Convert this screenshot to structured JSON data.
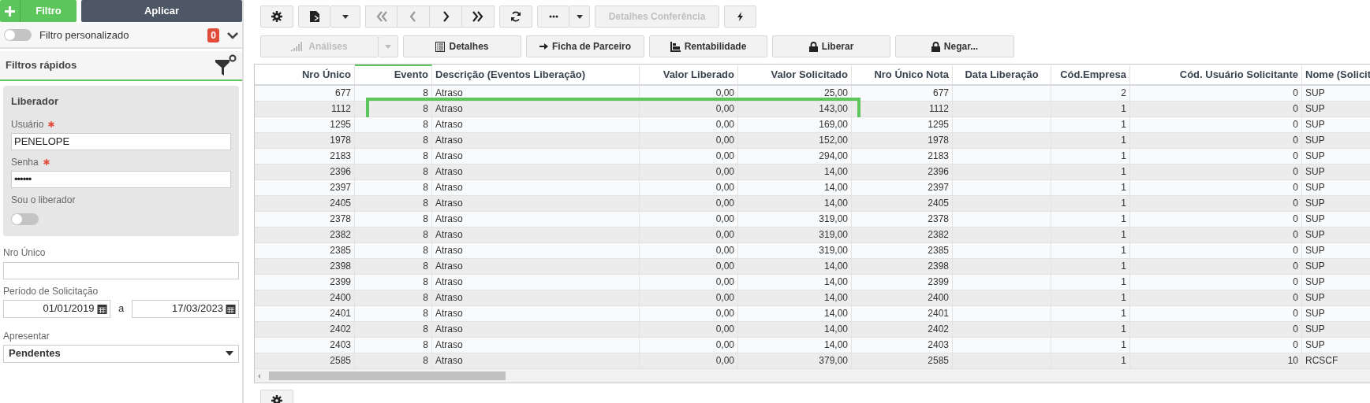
{
  "sidebar": {
    "filter_button": "Filtro",
    "apply_button": "Aplicar",
    "custom_filter": {
      "label": "Filtro personalizado",
      "on": false,
      "count": "0"
    },
    "quick_filters": {
      "title": "Filtros rápidos"
    },
    "liberador": {
      "title": "Liberador",
      "fields": [
        {
          "label": "Usuário",
          "required": true,
          "value": "PENELOPE"
        },
        {
          "label": "Senha",
          "required": true,
          "value": "••••••"
        }
      ],
      "toggle": {
        "label": "Sou o liberador",
        "on": false
      }
    },
    "nro_unico": {
      "label": "Nro Único"
    },
    "periodo": {
      "label": "Período de Solicitação",
      "from": "01/01/2019",
      "separator": "a",
      "to": "17/03/2023"
    },
    "apresentar": {
      "label": "Apresentar",
      "value": "Pendentes"
    }
  },
  "toolbar": {
    "detail_button": {
      "label": "Detalhes Conferência",
      "disabled": true
    }
  },
  "actions": [
    {
      "label": "Análises",
      "disabled": true
    },
    {
      "label": "Detalhes",
      "disabled": false
    },
    {
      "label": "Ficha de Parceiro",
      "disabled": false
    },
    {
      "label": "Rentabilidade",
      "disabled": false
    },
    {
      "label": "Liberar",
      "disabled": false
    },
    {
      "label": "Negar...",
      "disabled": false
    }
  ],
  "table": {
    "columns": [
      {
        "label": "Nro Único",
        "sorted": false
      },
      {
        "label": "Evento",
        "sorted": true
      },
      {
        "label": "Descrição (Eventos Liberação)",
        "sorted": false
      },
      {
        "label": "Valor Liberado",
        "sorted": false
      },
      {
        "label": "Valor Solicitado",
        "sorted": false
      },
      {
        "label": "Nro Único Nota",
        "sorted": false
      },
      {
        "label": "Data Liberação",
        "sorted": false
      },
      {
        "label": "Cód.Empresa",
        "sorted": false
      },
      {
        "label": "Cód. Usuário Solicitante",
        "sorted": false
      },
      {
        "label": "Nome (Solicit",
        "sorted": false
      }
    ],
    "rows": [
      {
        "cells": [
          "677",
          "8",
          "Atraso",
          "0,00",
          "25,00",
          "677",
          null,
          "2",
          "0",
          "SUP"
        ],
        "highlighted": false
      },
      {
        "cells": [
          "1112",
          "8",
          "Atraso",
          "0,00",
          "143,00",
          "1112",
          null,
          "1",
          "0",
          "SUP"
        ],
        "highlighted": true
      },
      {
        "cells": [
          "1295",
          "8",
          "Atraso",
          "0,00",
          "169,00",
          "1295",
          null,
          "1",
          "0",
          "SUP"
        ],
        "highlighted": false
      },
      {
        "cells": [
          "1978",
          "8",
          "Atraso",
          "0,00",
          "152,00",
          "1978",
          null,
          "1",
          "0",
          "SUP"
        ],
        "highlighted": false
      },
      {
        "cells": [
          "2183",
          "8",
          "Atraso",
          "0,00",
          "294,00",
          "2183",
          null,
          "1",
          "0",
          "SUP"
        ],
        "highlighted": false
      },
      {
        "cells": [
          "2396",
          "8",
          "Atraso",
          "0,00",
          "14,00",
          "2396",
          null,
          "1",
          "0",
          "SUP"
        ],
        "highlighted": false
      },
      {
        "cells": [
          "2397",
          "8",
          "Atraso",
          "0,00",
          "14,00",
          "2397",
          null,
          "1",
          "0",
          "SUP"
        ],
        "highlighted": false
      },
      {
        "cells": [
          "2405",
          "8",
          "Atraso",
          "0,00",
          "14,00",
          "2405",
          null,
          "1",
          "0",
          "SUP"
        ],
        "highlighted": false
      },
      {
        "cells": [
          "2378",
          "8",
          "Atraso",
          "0,00",
          "319,00",
          "2378",
          null,
          "1",
          "0",
          "SUP"
        ],
        "highlighted": false
      },
      {
        "cells": [
          "2382",
          "8",
          "Atraso",
          "0,00",
          "319,00",
          "2382",
          null,
          "1",
          "0",
          "SUP"
        ],
        "highlighted": false
      },
      {
        "cells": [
          "2385",
          "8",
          "Atraso",
          "0,00",
          "319,00",
          "2385",
          null,
          "1",
          "0",
          "SUP"
        ],
        "highlighted": false
      },
      {
        "cells": [
          "2398",
          "8",
          "Atraso",
          "0,00",
          "14,00",
          "2398",
          null,
          "1",
          "0",
          "SUP"
        ],
        "highlighted": false
      },
      {
        "cells": [
          "2399",
          "8",
          "Atraso",
          "0,00",
          "14,00",
          "2399",
          null,
          "1",
          "0",
          "SUP"
        ],
        "highlighted": false
      },
      {
        "cells": [
          "2400",
          "8",
          "Atraso",
          "0,00",
          "14,00",
          "2400",
          null,
          "1",
          "0",
          "SUP"
        ],
        "highlighted": false
      },
      {
        "cells": [
          "2401",
          "8",
          "Atraso",
          "0,00",
          "14,00",
          "2401",
          null,
          "1",
          "0",
          "SUP"
        ],
        "highlighted": false
      },
      {
        "cells": [
          "2402",
          "8",
          "Atraso",
          "0,00",
          "14,00",
          "2402",
          null,
          "1",
          "0",
          "SUP"
        ],
        "highlighted": false
      },
      {
        "cells": [
          "2403",
          "8",
          "Atraso",
          "0,00",
          "14,00",
          "2403",
          null,
          "1",
          "0",
          "SUP"
        ],
        "highlighted": false
      },
      {
        "cells": [
          "2585",
          "8",
          "Atraso",
          "0,00",
          "379,00",
          "2585",
          null,
          "1",
          "10",
          "RCSCF"
        ],
        "highlighted": false
      }
    ]
  }
}
